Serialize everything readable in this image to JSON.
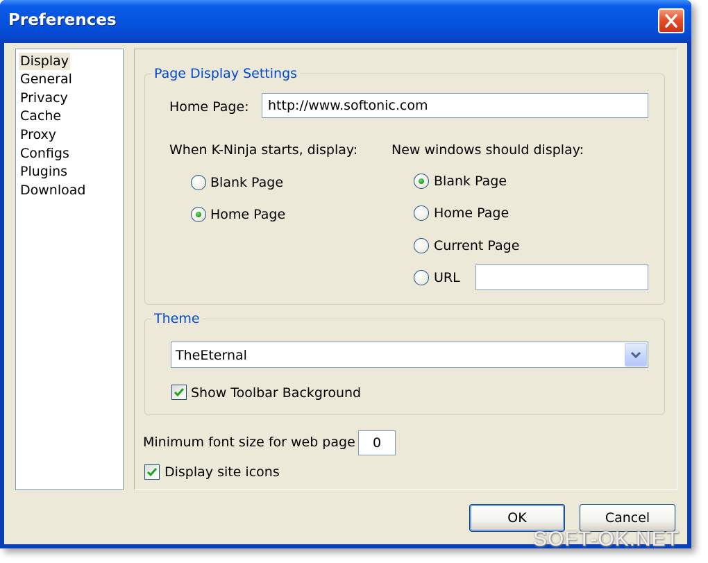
{
  "window": {
    "title": "Preferences"
  },
  "nav": {
    "items": [
      {
        "label": "Display"
      },
      {
        "label": "General"
      },
      {
        "label": "Privacy"
      },
      {
        "label": "Cache"
      },
      {
        "label": "Proxy"
      },
      {
        "label": "Configs"
      },
      {
        "label": "Plugins"
      },
      {
        "label": "Download"
      }
    ],
    "selected": "Display"
  },
  "page_display": {
    "title": "Page Display Settings",
    "home_page_label": "Home Page:",
    "home_page_value": "http://www.softonic.com",
    "startup": {
      "label": "When K-Ninja starts, display:",
      "options": [
        {
          "label": "Blank Page",
          "checked": false
        },
        {
          "label": "Home Page",
          "checked": true
        }
      ]
    },
    "new_windows": {
      "label": "New windows should display:",
      "options": [
        {
          "label": "Blank Page",
          "checked": true
        },
        {
          "label": "Home Page",
          "checked": false
        },
        {
          "label": "Current Page",
          "checked": false
        },
        {
          "label": "URL",
          "checked": false
        }
      ],
      "url_value": ""
    }
  },
  "theme": {
    "title": "Theme",
    "selected": "TheEternal",
    "show_toolbar_background": {
      "label": "Show Toolbar Background",
      "checked": true
    }
  },
  "min_font": {
    "label": "Minimum font size for web page",
    "value": "0"
  },
  "display_site_icons": {
    "label": "Display site icons",
    "checked": true
  },
  "buttons": {
    "ok": "OK",
    "cancel": "Cancel"
  },
  "watermark": "SOFT-OK.NET",
  "colors": {
    "titlebar": "#0a5ce8",
    "group_title": "#0046d5",
    "close_button": "#e4502a",
    "dialog_bg": "#ece9d8"
  }
}
